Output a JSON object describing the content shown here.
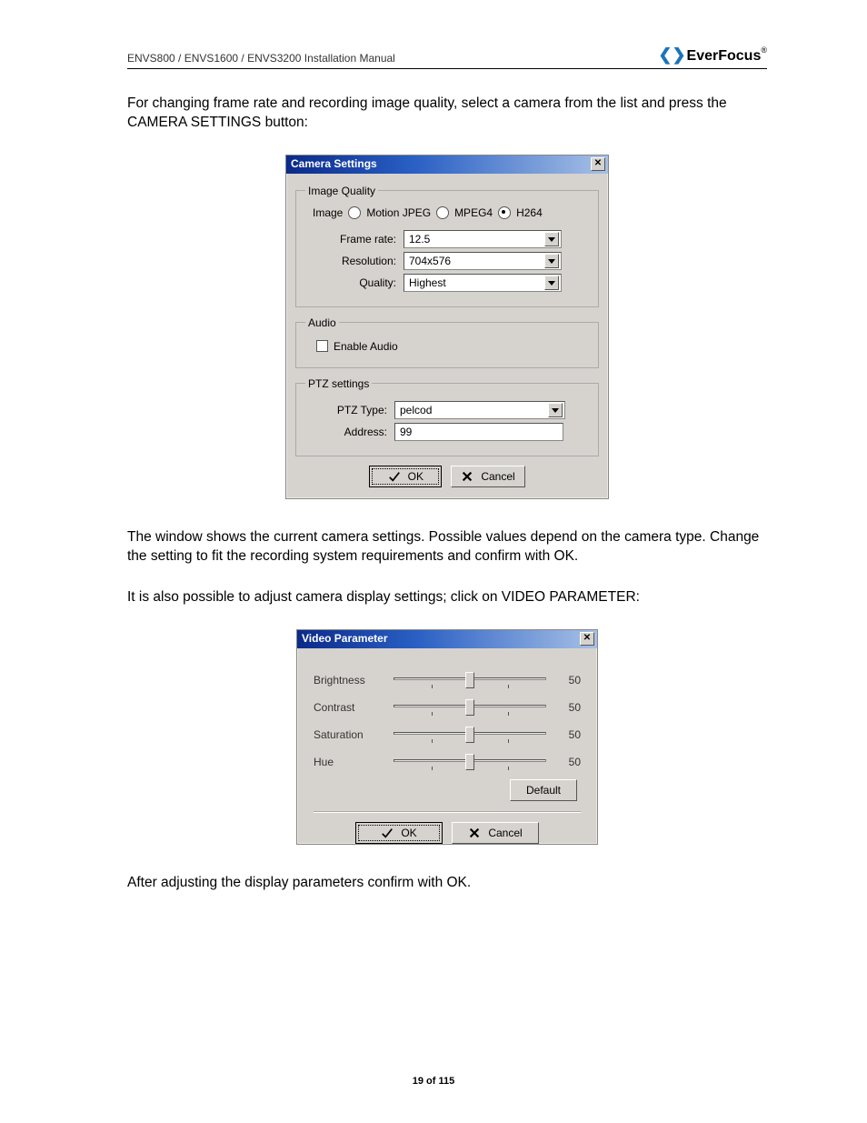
{
  "header": {
    "doc_title": "ENVS800 / ENVS1600 / ENVS3200 Installation Manual",
    "brand": "EverFocus"
  },
  "para1": "For changing frame rate and recording image quality, select a camera from the list and  press the CAMERA SETTINGS button:",
  "para2": "The window shows the current camera settings. Possible values depend on the camera type. Change the setting to fit the recording system requirements and confirm with OK.",
  "para3": "It is also possible to adjust camera display settings; click on VIDEO PARAMETER:",
  "para4": "After adjusting the display parameters confirm with OK.",
  "dlg1": {
    "title": "Camera Settings",
    "grp_image_quality": "Image Quality",
    "image_label": "Image",
    "radio_mjpeg": "Motion JPEG",
    "radio_mpeg4": "MPEG4",
    "radio_h264": "H264",
    "frame_rate_label": "Frame rate:",
    "frame_rate_value": "12.5",
    "resolution_label": "Resolution:",
    "resolution_value": "704x576",
    "quality_label": "Quality:",
    "quality_value": "Highest",
    "grp_audio": "Audio",
    "enable_audio": "Enable Audio",
    "grp_ptz": "PTZ settings",
    "ptz_type_label": "PTZ Type:",
    "ptz_type_value": "pelcod",
    "address_label": "Address:",
    "address_value": "99",
    "ok": "OK",
    "cancel": "Cancel"
  },
  "dlg2": {
    "title": "Video Parameter",
    "brightness_label": "Brightness",
    "brightness_value": "50",
    "contrast_label": "Contrast",
    "contrast_value": "50",
    "saturation_label": "Saturation",
    "saturation_value": "50",
    "hue_label": "Hue",
    "hue_value": "50",
    "default": "Default",
    "ok": "OK",
    "cancel": "Cancel"
  },
  "page_number": "19 of 115"
}
